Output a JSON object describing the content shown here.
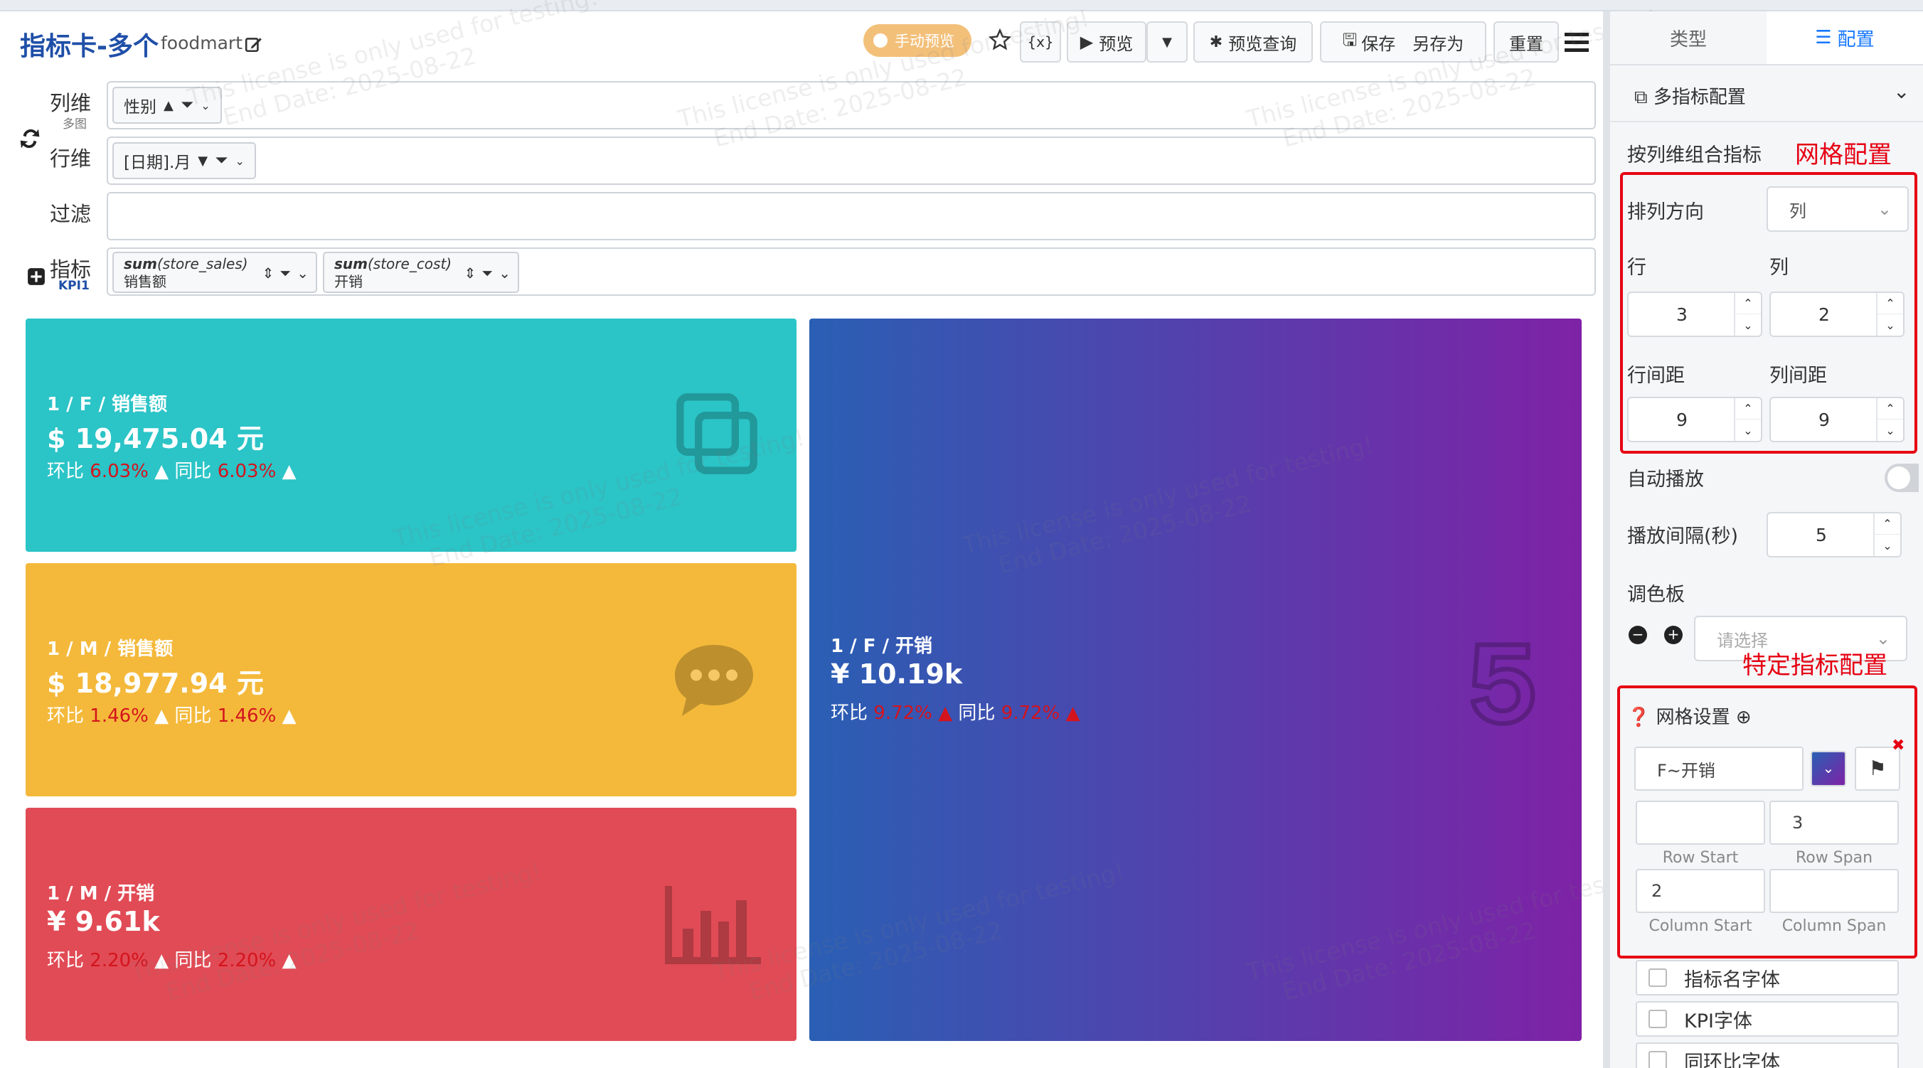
{
  "header": {
    "title": "指标卡-多个",
    "subtitle": "foodmart",
    "manual_preview": "手动预览",
    "fx_label": "{x}",
    "preview_label": "预览",
    "preview_query_label": "预览查询",
    "save_label": "保存",
    "save_as_label": "另存为",
    "reset_label": "重置"
  },
  "config": {
    "columns": {
      "label": "列维",
      "sub": "多图",
      "chip": "性别"
    },
    "rows": {
      "label": "行维",
      "chip": "[日期].月"
    },
    "filter": {
      "label": "过滤"
    },
    "metrics": {
      "label": "指标",
      "sub": "KPI1",
      "items": [
        {
          "func": "sum",
          "field": "(store_sales)",
          "alias": "销售额"
        },
        {
          "func": "sum",
          "field": "(store_cost)",
          "alias": "开销"
        }
      ]
    }
  },
  "cards": [
    {
      "title": "1 / F / 销售额",
      "value": "$ 19,475.04 元",
      "mom_label": "环比",
      "mom": "6.03%",
      "yoy_label": "同比",
      "yoy": "6.03%",
      "color": "#2bc4c7",
      "icon": "copy-icon"
    },
    {
      "title": "1 / M / 销售额",
      "value": "$ 18,977.94 元",
      "mom_label": "环比",
      "mom": "1.46%",
      "yoy_label": "同比",
      "yoy": "1.46%",
      "color": "#f4b93b",
      "icon": "chat-bubble-icon"
    },
    {
      "title": "1 / M / 开销",
      "value": "¥ 9.61k",
      "mom_label": "环比",
      "mom": "2.20%",
      "yoy_label": "同比",
      "yoy": "2.20%",
      "color": "#e14b55",
      "icon": "bar-chart-icon"
    },
    {
      "title": "1 / F / 开销",
      "value": "¥ 10.19k",
      "mom_label": "环比",
      "mom": "9.72%",
      "yoy_label": "同比",
      "yoy": "9.72%",
      "color_start": "#2a5fb4",
      "color_end": "#7e22a6",
      "icon": "five-icon"
    }
  ],
  "watermark": {
    "line1": "This license is only used for testing!",
    "line2": "End Date: 2025-08-22"
  },
  "panel": {
    "tab_type": "类型",
    "tab_config": "配置",
    "section_title": "多指标配置",
    "combine_label": "按列维组合指标",
    "grid_config_note": "网格配置",
    "direction_label": "排列方向",
    "direction_value": "列",
    "row_label": "行",
    "col_label": "列",
    "row_value": "3",
    "col_value": "2",
    "row_gap_label": "行间距",
    "col_gap_label": "列间距",
    "row_gap_value": "9",
    "col_gap_value": "9",
    "autoplay_label": "自动播放",
    "interval_label": "播放间隔(秒)",
    "interval_value": "5",
    "palette_label": "调色板",
    "palette_placeholder": "请选择",
    "specific_note": "特定指标配置",
    "grid_settings_label": "网格设置",
    "grid_item_name": "F~开销",
    "row_start_value": "",
    "row_span_value": "3",
    "col_start_value": "2",
    "col_span_value": "",
    "row_start_caption": "Row Start",
    "row_span_caption": "Row Span",
    "col_start_caption": "Column Start",
    "col_span_caption": "Column Span",
    "font_options": [
      "指标名字体",
      "KPI字体",
      "同环比字体"
    ]
  }
}
